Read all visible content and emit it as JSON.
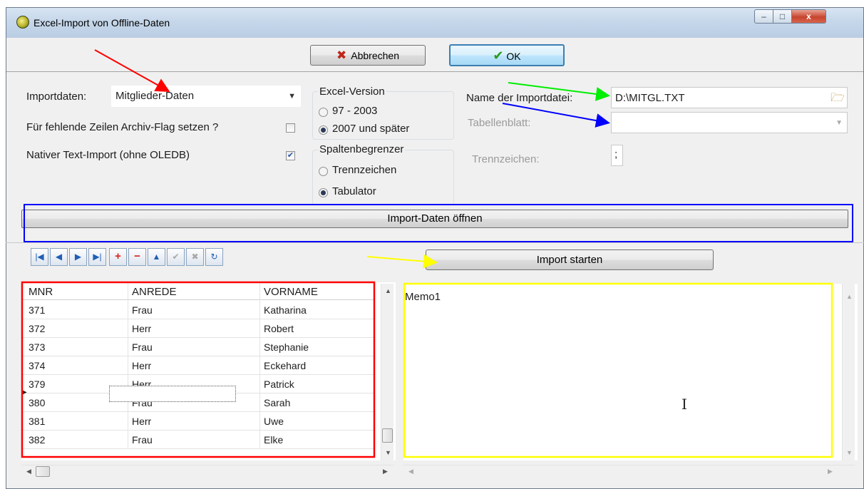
{
  "window": {
    "title": "Excel-Import von Offline-Daten",
    "caption_buttons": {
      "minimize": "–",
      "maximize": "□",
      "close": "x"
    }
  },
  "toolbar": {
    "cancel_label": "Abbrechen",
    "ok_label": "OK"
  },
  "form": {
    "importdaten_label": "Importdaten:",
    "importdaten_value": "Mitglieder-Daten",
    "archive_flag_label": "Für fehlende Zeilen Archiv-Flag setzen ?",
    "archive_flag_checked": false,
    "native_import_label": "Nativer Text-Import (ohne OLEDB)",
    "native_import_checked": true,
    "excel_version": {
      "title": "Excel-Version",
      "options": [
        "97 - 2003",
        "2007 und später"
      ],
      "selected": "2007 und später"
    },
    "spaltenbegrenzer": {
      "title": "Spaltenbegrenzer",
      "options": [
        "Trennzeichen",
        "Tabulator"
      ],
      "selected": "Tabulator"
    },
    "filename_label": "Name der Importdatei:",
    "filename_value": "D:\\MITGL.TXT",
    "tabellenblatt_label": "Tabellenblatt:",
    "tabellenblatt_value": "",
    "trennzeichen_label": "Trennzeichen:",
    "trennzeichen_value": ";"
  },
  "actions": {
    "open_label": "Import-Daten öffnen",
    "start_label": "Import starten"
  },
  "navigator": {
    "icons": [
      "first-icon",
      "prior-icon",
      "next-icon",
      "last-icon",
      "insert-icon",
      "delete-icon",
      "edit-icon",
      "post-icon",
      "cancel-icon",
      "refresh-icon"
    ],
    "glyphs": [
      "|◀",
      "◀",
      "▶",
      "▶|",
      "+",
      "−",
      "▲",
      "✔",
      "✖",
      "↻"
    ]
  },
  "grid": {
    "columns": [
      "MNR",
      "ANREDE",
      "VORNAME"
    ],
    "rows": [
      [
        "371",
        "Frau",
        "Katharina"
      ],
      [
        "372",
        "Herr",
        "Robert"
      ],
      [
        "373",
        "Frau",
        "Stephanie"
      ],
      [
        "374",
        "Herr",
        "Eckehard"
      ],
      [
        "379",
        "Herr",
        "Patrick"
      ],
      [
        "380",
        "Frau",
        "Sarah"
      ],
      [
        "381",
        "Herr",
        "Uwe"
      ],
      [
        "382",
        "Frau",
        "Elke"
      ]
    ],
    "current_row_index": 4,
    "current_row_indicator": "▶"
  },
  "memo": {
    "text": "Memo1"
  },
  "annotation_colors": {
    "red": "#ff0000",
    "green": "#00ff00",
    "blue": "#0000ff",
    "yellow": "#ffff00"
  }
}
